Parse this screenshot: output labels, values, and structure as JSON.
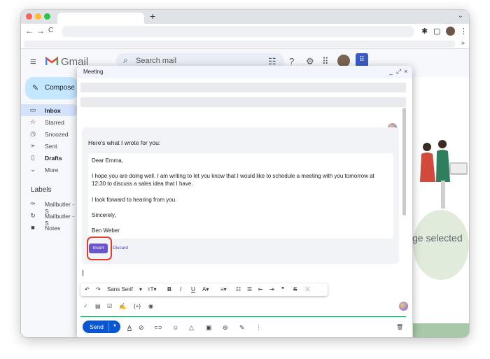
{
  "browser": {
    "new_tab": "+",
    "nav": {
      "back": "←",
      "forward": "→",
      "reload": "C"
    },
    "toolbar_icons": {
      "extensions": "✱",
      "sidepanel": "▢",
      "menu": "⋮",
      "tabs_chevron": "⌄",
      "bookmarks_more": "»"
    }
  },
  "gmail": {
    "logo_text": "Gmail",
    "search_placeholder": "Search mail",
    "compose_label": "Compose",
    "nav": [
      {
        "label": "Inbox",
        "icon": "▭"
      },
      {
        "label": "Starred",
        "icon": "☆"
      },
      {
        "label": "Snoozed",
        "icon": "◷"
      },
      {
        "label": "Sent",
        "icon": "➢"
      },
      {
        "label": "Drafts",
        "icon": "▯"
      },
      {
        "label": "More",
        "icon": "⌄"
      }
    ],
    "labels_title": "Labels",
    "labels": [
      {
        "label": "Mailbutler - S",
        "icon": "✑"
      },
      {
        "label": "Mailbutler - S",
        "icon": "↻"
      },
      {
        "label": "Notes",
        "icon": "■"
      }
    ],
    "selection_text": "ge selected",
    "accent": "#0b57d0"
  },
  "compose": {
    "title": "Meeting",
    "controls": {
      "minimize": "_",
      "popout": "⤢",
      "close": "×"
    },
    "ai": {
      "heading": "Here's what I wrote for you:",
      "letter": [
        "Dear Emma,",
        "I hope you are doing well. I am writing to let you know that I would like to schedule a meeting with you tomorrow at 12:30 to discuss a sales idea that I have.",
        "I look forward to hearing from you.",
        "Sincerely,",
        "Ben Weber"
      ],
      "insert_label": "Insert",
      "discard_label": "Discard"
    },
    "format": {
      "undo": "↶",
      "redo": "↷",
      "font": "Sans Serif",
      "font_arrow": "▾",
      "size": "тT▾",
      "bold": "B",
      "italic": "I",
      "underline": "U",
      "color": "A▾",
      "align": "≡▾",
      "numbered": "☷",
      "bulleted": "☰",
      "indent_less": "⇤",
      "indent_more": "⇥",
      "quote": "❞",
      "strike": "S",
      "clear": "⤫"
    },
    "ext": {
      "check": "✓",
      "template": "▤",
      "task": "☑",
      "sign": "✍",
      "code": "{+}",
      "eye": "◉"
    },
    "send_label": "Send",
    "send_arrow": "▼",
    "bottom_icons": {
      "format": "A",
      "attach": "⊘",
      "link": "⊂⊃",
      "emoji": "☺",
      "drive": "△",
      "photo": "▣",
      "lock": "⊕",
      "pen": "✎",
      "more": "⋮",
      "delete": "🗑"
    }
  }
}
